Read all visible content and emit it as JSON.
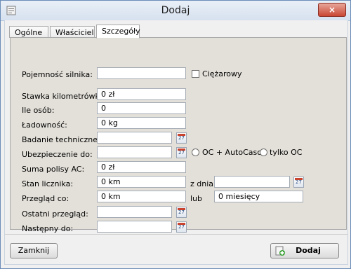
{
  "window": {
    "title": "Dodaj",
    "close_glyph": "×"
  },
  "tabs": [
    {
      "label": "Ogólne"
    },
    {
      "label": "Właściciel"
    },
    {
      "label": "Szczegóły"
    }
  ],
  "form": {
    "engine_capacity": {
      "label": "Pojemność silnika:",
      "value": ""
    },
    "truck": {
      "label": "Ciężarowy",
      "checked": false
    },
    "km_rate": {
      "label": "Stawka kilometrówki:",
      "value": "0 zł"
    },
    "persons": {
      "label": "Ile osób:",
      "value": "0"
    },
    "load_capacity": {
      "label": "Ładowność:",
      "value": "0 kg"
    },
    "technical_inspection": {
      "label": "Badanie techniczne do:",
      "value": "",
      "calendar_icon": "calendar-icon"
    },
    "insurance": {
      "label": "Ubezpieczenie do:",
      "value": "",
      "calendar_icon": "calendar-icon",
      "options": [
        {
          "label": "OC + AutoCasco",
          "selected": false
        },
        {
          "label": "tylko OC",
          "selected": false
        }
      ]
    },
    "ac_sum": {
      "label": "Suma polisy AC:",
      "value": "0 zł"
    },
    "odometer": {
      "label": "Stan licznika:",
      "value": "0 km",
      "date_label": "z dnia:",
      "date_value": ""
    },
    "service_every": {
      "label": "Przegląd co:",
      "value": "0 km",
      "or_label": "lub",
      "months_value": "0 miesięcy"
    },
    "last_service": {
      "label": "Ostatni przegląd:",
      "value": ""
    },
    "next_service": {
      "label": "Następny do:",
      "value": ""
    }
  },
  "calendar_glyph": "27",
  "buttons": {
    "close": "Zamknij",
    "add": "Dodaj"
  },
  "colors": {
    "panel_bg": "#e3e0d9",
    "title_bar": "#dce6f2",
    "close_button": "#c94633"
  }
}
